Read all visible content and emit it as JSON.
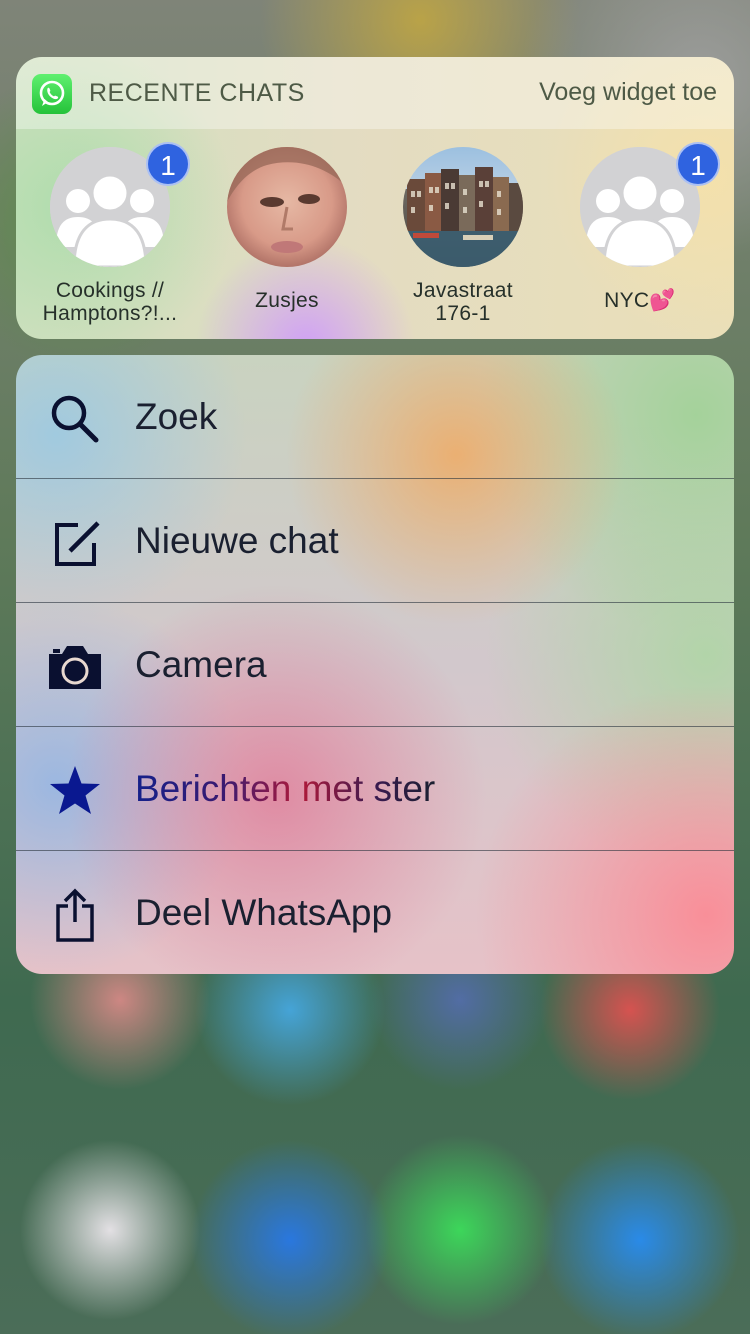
{
  "widget": {
    "title": "RECENTE CHATS",
    "add_label": "Voeg widget toe",
    "chats": [
      {
        "name": "Cookings //\nHamptons?!...",
        "line1": "Cookings //",
        "line2": "Hamptons?!...",
        "badge": "1",
        "avatar": "group-avatar-icon"
      },
      {
        "name": "Zusjes",
        "line1": "Zusjes",
        "line2": "",
        "badge": "",
        "avatar": "photo-avatar"
      },
      {
        "name": "Javastraat 176-1",
        "line1": "Javastraat",
        "line2": "176-1",
        "badge": "",
        "avatar": "canal-houses-photo"
      },
      {
        "name": "NYC💕",
        "line1": "NYC💕",
        "line2": "",
        "badge": "1",
        "avatar": "group-avatar-icon"
      }
    ]
  },
  "menu": {
    "items": [
      {
        "label": "Zoek",
        "icon": "search-icon"
      },
      {
        "label": "Nieuwe chat",
        "icon": "compose-icon"
      },
      {
        "label": "Camera",
        "icon": "camera-icon"
      },
      {
        "label": "Berichten met ster",
        "icon": "star-icon"
      },
      {
        "label": "Deel WhatsApp",
        "icon": "share-icon"
      }
    ]
  },
  "colors": {
    "badge": "#2f63e0",
    "whatsapp_green": "#25c23a",
    "menu_text": "#1a2030",
    "icon": "#0a1030"
  }
}
